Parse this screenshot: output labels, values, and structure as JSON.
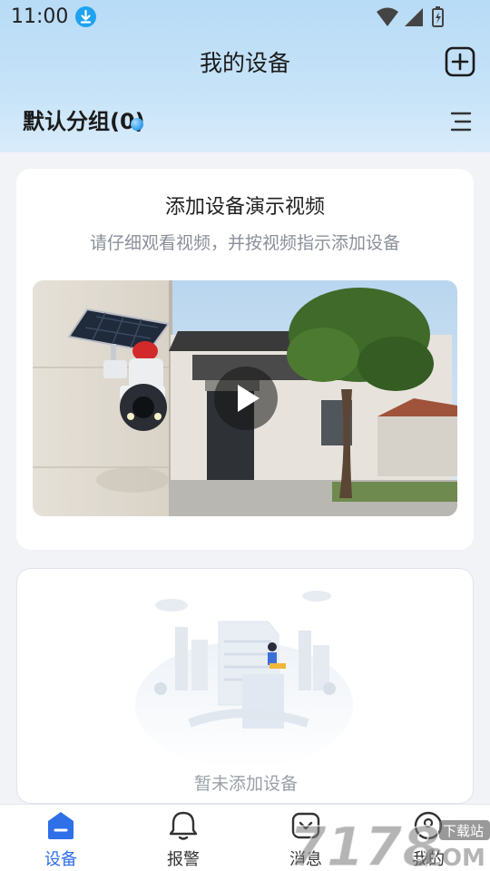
{
  "status_bar": {
    "time": "11:00"
  },
  "header": {
    "title": "我的设备"
  },
  "group": {
    "title": "默认分组(0)"
  },
  "video_card": {
    "title": "添加设备演示视频",
    "subtitle": "请仔细观看视频，并按视频指示添加设备"
  },
  "empty_card": {
    "text": "暂未添加设备"
  },
  "tabs": [
    {
      "label": "设备",
      "icon": "home-icon",
      "active": true
    },
    {
      "label": "报警",
      "icon": "bell-icon",
      "active": false
    },
    {
      "label": "消息",
      "icon": "message-icon",
      "active": false
    },
    {
      "label": "我的",
      "icon": "profile-icon",
      "active": false
    }
  ],
  "watermark": {
    "text": "7178",
    "suffix": ".COM",
    "badge": "下载站"
  },
  "colors": {
    "accent": "#2f6fe8",
    "header_bg": "#c6e3f8",
    "download_badge": "#1fa2f0"
  }
}
